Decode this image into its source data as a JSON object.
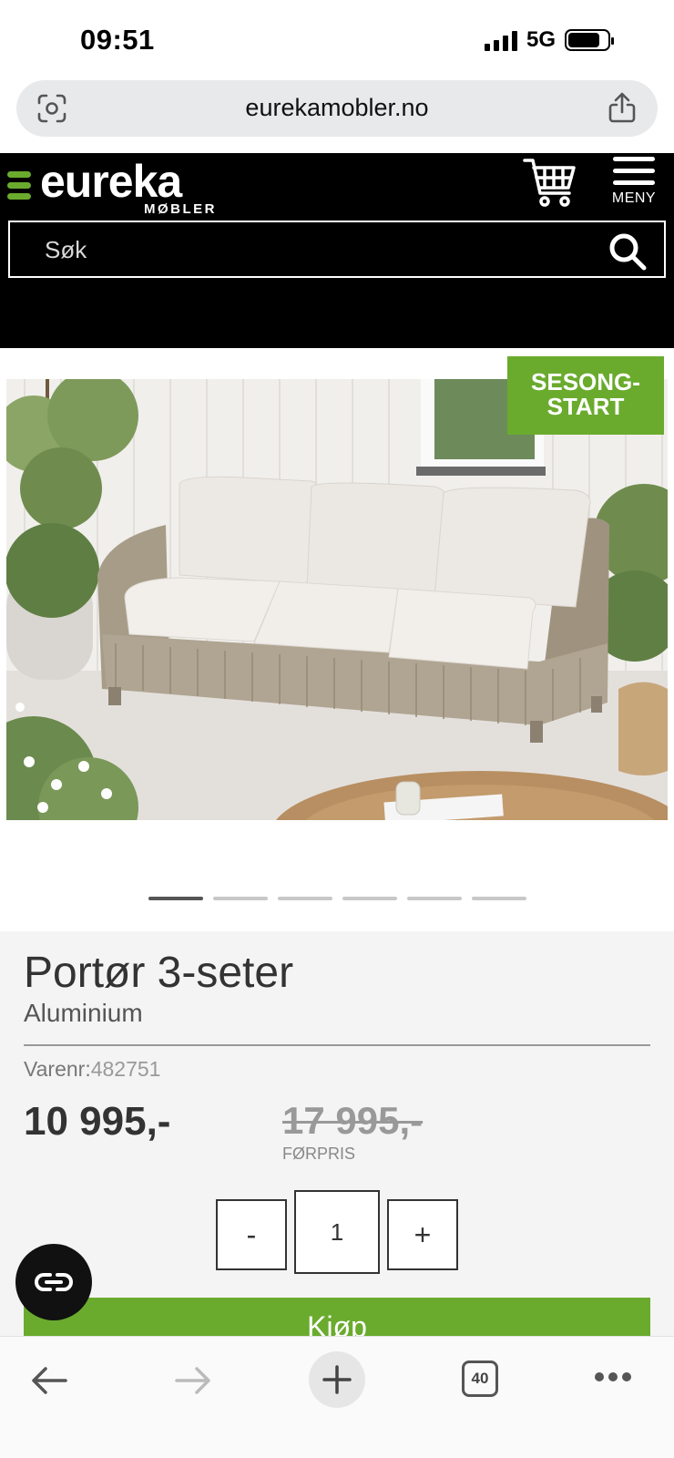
{
  "status_bar": {
    "time": "09:51",
    "network": "5G"
  },
  "browser": {
    "url": "eurekamobler.no",
    "tabs_count": "40"
  },
  "header": {
    "logo_text": "eureka",
    "logo_subtext": "MØBLER",
    "menu_label": "MENY",
    "search_placeholder": "Søk"
  },
  "product": {
    "badge_line1": "SESONG-",
    "badge_line2": "START",
    "title": "Portør 3-seter",
    "variant": "Aluminium",
    "sku_label": "Varenr:",
    "sku_value": "482751",
    "price": "10 995,-",
    "old_price": "17 995,-",
    "old_price_label": "FØRPRIS",
    "quantity": "1",
    "qty_minus": "-",
    "qty_plus": "+",
    "buy_label": "Kjøp",
    "gallery_count": 6,
    "gallery_active_index": 0
  },
  "colors": {
    "brand_green": "#6aab2e",
    "header_bg": "#000000",
    "panel_bg": "#f4f4f4"
  },
  "icons": {
    "url_left": "screen-capture-icon",
    "url_right": "share-icon",
    "cart": "cart-icon",
    "menu": "hamburger-icon",
    "search": "search-icon",
    "chat": "chat-icon",
    "back": "back-arrow-icon",
    "forward": "forward-arrow-icon",
    "new_tab": "plus-icon",
    "more": "more-icon"
  }
}
